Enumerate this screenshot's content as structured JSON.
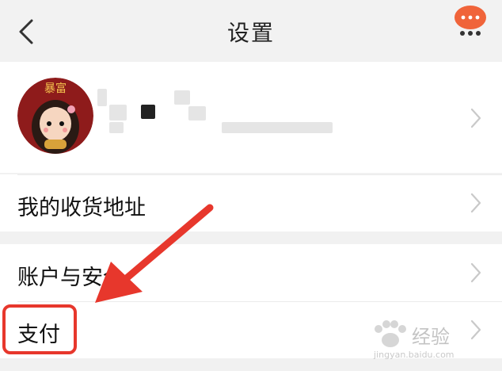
{
  "header": {
    "title": "设置",
    "back_icon": "chevron-left-icon",
    "more_icon": "more-icon"
  },
  "profile": {
    "avatar_text": "暴富"
  },
  "rows": [
    {
      "label": "我的收货地址"
    },
    {
      "label": "账户与安全"
    },
    {
      "label": "支付"
    }
  ],
  "colors": {
    "highlight": "#e7372c",
    "arrow": "#e7372c",
    "more_bg": "#f0643a"
  },
  "watermark": {
    "text": "经验",
    "url_text": "jingyan.baidu.com"
  }
}
